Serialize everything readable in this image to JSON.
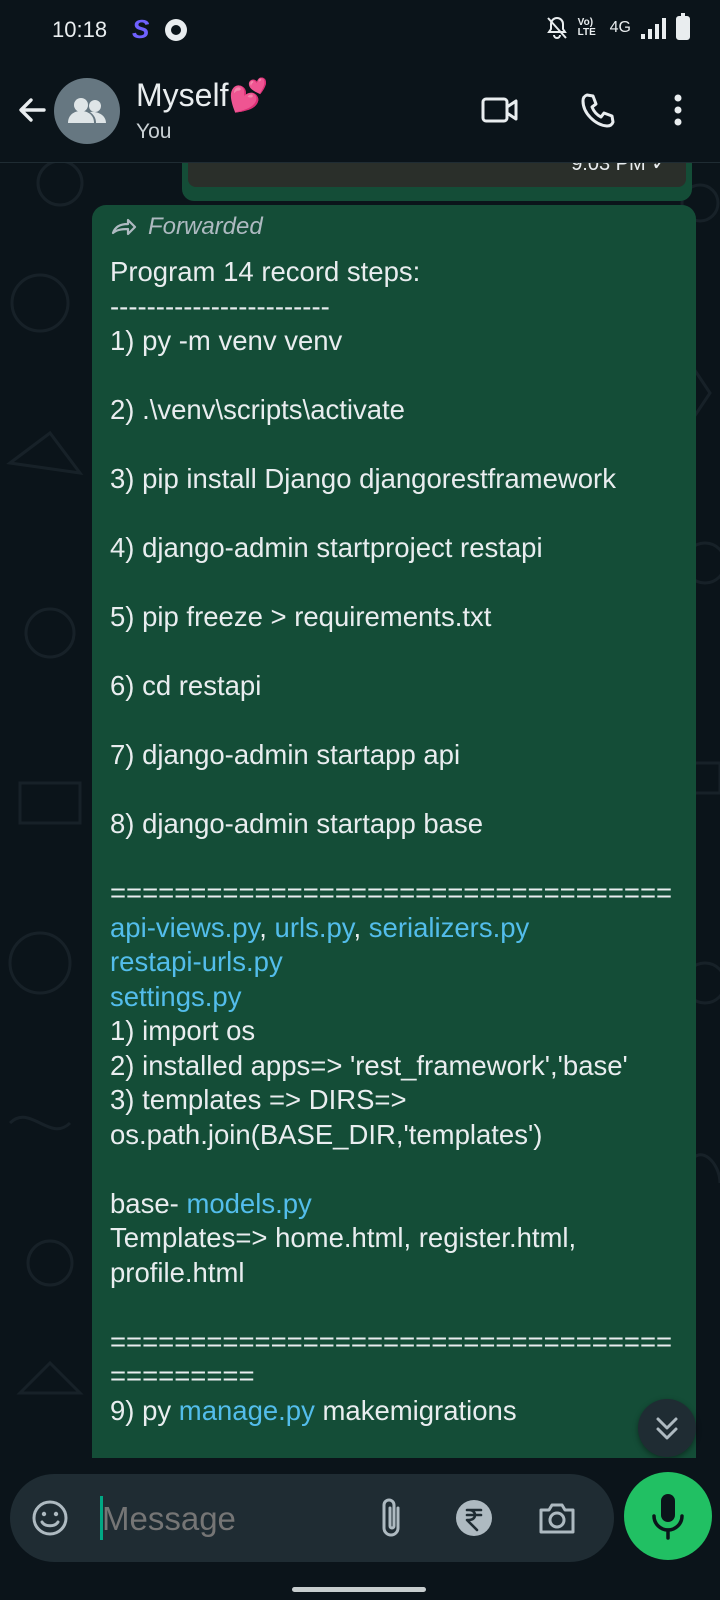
{
  "status_bar": {
    "time": "10:18",
    "network": "4G",
    "volte": "Vo) LTE"
  },
  "header": {
    "title": "Myself💕",
    "subtitle": "You",
    "icons": [
      "back-arrow-icon",
      "group-avatar-icon",
      "video-call-icon",
      "voice-call-icon",
      "more-options-icon"
    ]
  },
  "previous_message": {
    "time": "9:03 PM",
    "status": "✓"
  },
  "message": {
    "forwarded_label": "Forwarded",
    "lines": [
      {
        "parts": [
          {
            "t": "Program 14 record steps:"
          }
        ]
      },
      {
        "parts": [
          {
            "t": "------------------------"
          }
        ]
      },
      {
        "parts": [
          {
            "t": "1) py -m venv venv"
          }
        ]
      },
      {
        "parts": []
      },
      {
        "parts": [
          {
            "t": "2) .\\venv\\scripts\\activate"
          }
        ]
      },
      {
        "parts": []
      },
      {
        "parts": [
          {
            "t": "3) pip install Django djangorestframework"
          }
        ]
      },
      {
        "parts": []
      },
      {
        "parts": [
          {
            "t": "4) django-admin startproject restapi"
          }
        ]
      },
      {
        "parts": []
      },
      {
        "parts": [
          {
            "t": "5) pip freeze > requirements.txt"
          }
        ]
      },
      {
        "parts": []
      },
      {
        "parts": [
          {
            "t": "6) cd restapi"
          }
        ]
      },
      {
        "parts": []
      },
      {
        "parts": [
          {
            "t": "7) django-admin startapp api"
          }
        ]
      },
      {
        "parts": []
      },
      {
        "parts": [
          {
            "t": "8) django-admin startapp base"
          }
        ]
      },
      {
        "parts": []
      },
      {
        "parts": [
          {
            "t": "==================================="
          }
        ]
      },
      {
        "parts": [
          {
            "t": "api-views.py",
            "link": true
          },
          {
            "t": ", "
          },
          {
            "t": "urls.py",
            "link": true
          },
          {
            "t": ", "
          },
          {
            "t": "serializers.py",
            "link": true
          }
        ]
      },
      {
        "parts": [
          {
            "t": "restapi-urls.py",
            "link": true
          }
        ]
      },
      {
        "parts": [
          {
            "t": "settings.py",
            "link": true
          }
        ]
      },
      {
        "parts": [
          {
            "t": "1) import os"
          }
        ]
      },
      {
        "parts": [
          {
            "t": "2) installed apps=> 'rest_framework','base'"
          }
        ]
      },
      {
        "parts": [
          {
            "t": "3) templates => DIRS=>"
          }
        ]
      },
      {
        "parts": [
          {
            "t": "os.path.join(BASE_DIR,'templates')"
          }
        ]
      },
      {
        "parts": []
      },
      {
        "parts": [
          {
            "t": "base- "
          },
          {
            "t": "models.py",
            "link": true
          }
        ]
      },
      {
        "parts": [
          {
            "t": "Templates=> home.html, register.html,"
          }
        ]
      },
      {
        "parts": [
          {
            "t": "profile.html"
          }
        ]
      },
      {
        "parts": []
      },
      {
        "parts": [
          {
            "t": "==================================="
          }
        ]
      },
      {
        "parts": [
          {
            "t": "========="
          }
        ]
      },
      {
        "parts": [
          {
            "t": "9) py "
          },
          {
            "t": "manage.py",
            "link": true
          },
          {
            "t": " makemigrations"
          }
        ]
      }
    ]
  },
  "composer": {
    "placeholder": "Message",
    "icons": [
      "emoji-icon",
      "attach-icon",
      "rupee-payment-icon",
      "camera-icon",
      "mic-icon"
    ]
  },
  "colors": {
    "background": "#0b141a",
    "bubble_outgoing": "#144d37",
    "link": "#53bdeb",
    "accent": "#21c063"
  }
}
